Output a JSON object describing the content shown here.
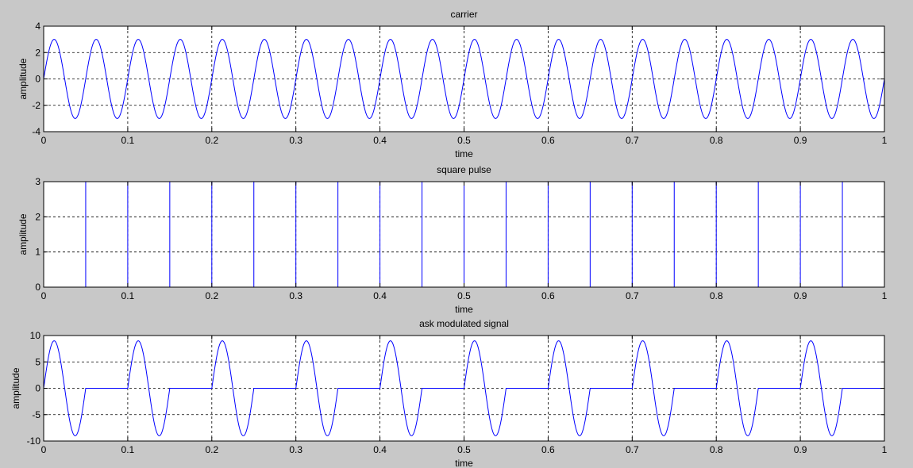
{
  "figure": {
    "background": "#c8c8c8"
  },
  "chart_data": [
    {
      "type": "line",
      "title": "carrier",
      "xlabel": "time",
      "ylabel": "amplitude",
      "xlim": [
        0,
        1
      ],
      "ylim": [
        -4,
        4
      ],
      "xticks": [
        0,
        0.1,
        0.2,
        0.3,
        0.4,
        0.5,
        0.6,
        0.7,
        0.8,
        0.9,
        1
      ],
      "xtick_labels": [
        "0",
        "0.1",
        "0.2",
        "0.3",
        "0.4",
        "0.5",
        "0.6",
        "0.7",
        "0.8",
        "0.9",
        "1"
      ],
      "yticks": [
        -4,
        -2,
        0,
        2,
        4
      ],
      "ytick_labels": [
        "-4",
        "-2",
        "0",
        "2",
        "4"
      ],
      "grid": true,
      "series": [
        {
          "color": "#0000ff",
          "kind": "sine",
          "amplitude": 3,
          "frequency_hz": 20,
          "x_range": [
            0,
            1
          ]
        }
      ]
    },
    {
      "type": "line",
      "title": "square pulse",
      "xlabel": "time",
      "ylabel": "amplitude",
      "xlim": [
        0,
        1
      ],
      "ylim": [
        0,
        3
      ],
      "xticks": [
        0,
        0.1,
        0.2,
        0.3,
        0.4,
        0.5,
        0.6,
        0.7,
        0.8,
        0.9,
        1
      ],
      "xtick_labels": [
        "0",
        "0.1",
        "0.2",
        "0.3",
        "0.4",
        "0.5",
        "0.6",
        "0.7",
        "0.8",
        "0.9",
        "1"
      ],
      "yticks": [
        0,
        1,
        2,
        3
      ],
      "ytick_labels": [
        "0",
        "1",
        "2",
        "3"
      ],
      "grid": true,
      "series": [
        {
          "color": "#0000ff",
          "kind": "square",
          "high": 3,
          "low": 0,
          "frequency_hz": 10,
          "x_range": [
            0,
            1
          ]
        }
      ]
    },
    {
      "type": "line",
      "title": "ask modulated signal",
      "xlabel": "time",
      "ylabel": "amplitude",
      "xlim": [
        0,
        1
      ],
      "ylim": [
        -10,
        10
      ],
      "xticks": [
        0,
        0.1,
        0.2,
        0.3,
        0.4,
        0.5,
        0.6,
        0.7,
        0.8,
        0.9,
        1
      ],
      "xtick_labels": [
        "0",
        "0.1",
        "0.2",
        "0.3",
        "0.4",
        "0.5",
        "0.6",
        "0.7",
        "0.8",
        "0.9",
        "1"
      ],
      "yticks": [
        -10,
        -5,
        0,
        5,
        10
      ],
      "ytick_labels": [
        "-10",
        "-5",
        "0",
        "5",
        "10"
      ],
      "grid": true,
      "series": [
        {
          "color": "#0000ff",
          "kind": "ask",
          "amplitude": 9,
          "frequency_hz": 20,
          "gate_frequency_hz": 10,
          "x_range": [
            0,
            1
          ]
        }
      ]
    }
  ]
}
